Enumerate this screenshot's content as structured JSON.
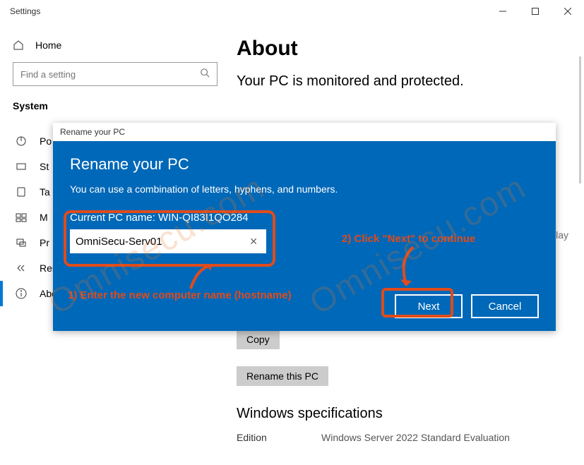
{
  "window": {
    "title": "Settings"
  },
  "sidebar": {
    "home": "Home",
    "search_placeholder": "Find a setting",
    "category": "System",
    "items": [
      {
        "label": "Po",
        "icon": "power"
      },
      {
        "label": "St",
        "icon": "storage"
      },
      {
        "label": "Ta",
        "icon": "tablet"
      },
      {
        "label": "M",
        "icon": "multitask"
      },
      {
        "label": "Pr",
        "icon": "project"
      },
      {
        "label": "Remote Desktop",
        "icon": "remote"
      },
      {
        "label": "About",
        "icon": "info",
        "selected": true
      }
    ]
  },
  "main": {
    "title": "About",
    "subtitle": "Your PC is monitored and protected.",
    "copy_label": "Copy",
    "rename_label": "Rename this PC",
    "overlay_suffix": "lay",
    "specs_title": "Windows specifications",
    "spec": {
      "label": "Edition",
      "value": "Windows Server 2022 Standard Evaluation"
    }
  },
  "dialog": {
    "window_title": "Rename your PC",
    "heading": "Rename your PC",
    "sub": "You can use a combination of letters, hyphens, and numbers.",
    "current_label": "Current PC name: WIN-QI83I1QO284",
    "input_value": "OmniSecu-Serv01",
    "next": "Next",
    "cancel": "Cancel"
  },
  "annotations": {
    "step1": "1) Enter the new computer name (hostname)",
    "step2": "2) Click \"Next\" to continue"
  },
  "watermark": "Omnisecu.com"
}
